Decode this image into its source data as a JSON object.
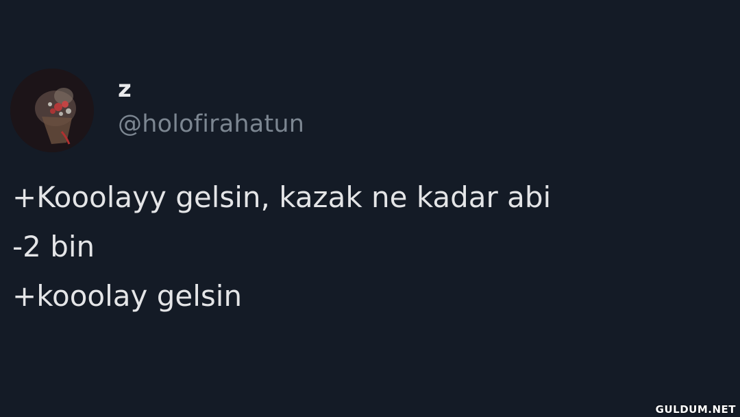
{
  "tweet": {
    "author": {
      "display_name": "z",
      "handle": "@holofirahatun",
      "avatar_icon": "flower-bouquet-avatar"
    },
    "lines": [
      "+Kooolayy gelsin, kazak ne kadar abi",
      "-2 bin",
      "+kooolay gelsin"
    ]
  },
  "watermark": "GULDUM.NET",
  "colors": {
    "background": "#141b26",
    "text_primary": "#e4e5e7",
    "text_secondary": "#7c8691"
  }
}
